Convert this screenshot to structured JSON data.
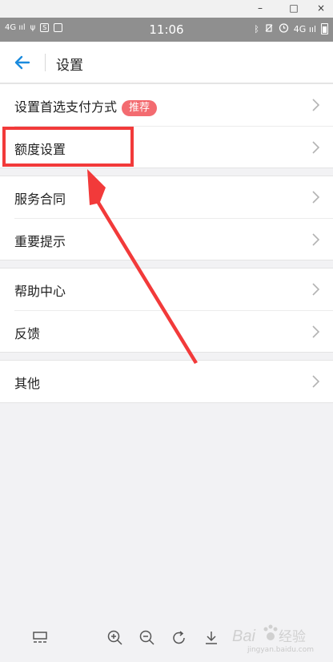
{
  "window_controls": {
    "minimize": "–",
    "maximize": "□",
    "close": "×"
  },
  "status_bar": {
    "left_network": "4G",
    "left_signal": "ııl",
    "usb": "ψ",
    "sim_label": "S",
    "time": "11:06",
    "bluetooth": "ᛒ",
    "right_network": "4G",
    "right_signal": "ııl"
  },
  "header": {
    "title": "设置"
  },
  "groups": [
    {
      "items": [
        {
          "label": "设置首选支付方式",
          "badge": "推荐"
        },
        {
          "label": "额度设置"
        }
      ]
    },
    {
      "items": [
        {
          "label": "服务合同"
        },
        {
          "label": "重要提示"
        }
      ]
    },
    {
      "items": [
        {
          "label": "帮助中心"
        },
        {
          "label": "反馈"
        }
      ]
    },
    {
      "items": [
        {
          "label": "其他"
        }
      ]
    }
  ],
  "watermark": {
    "brand_left": "Bai",
    "brand_right": "经验",
    "url": "jingyan.baidu.com"
  },
  "colors": {
    "accent": "#1b8bde",
    "badge": "#f36b70",
    "annotation": "#f23a3a"
  }
}
